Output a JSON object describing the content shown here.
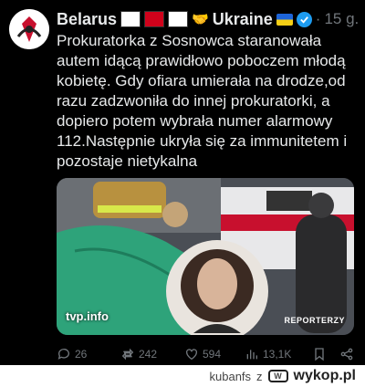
{
  "post": {
    "author_name": "Belarus",
    "author_suffix": "Ukraine",
    "separator": "·",
    "time": "15 g.",
    "text": "Prokuratorka z Sosnowca staranowała autem idącą prawidłowo poboczem młodą kobietę. Gdy ofiara umierała na drodze,od razu zadzwoniła do innej prokuratorki, a dopiero potem wybrała numer alarmowy 112.Następnie ukryła się za immunitetem i pozostaje nietykalna",
    "media_source": "tvp.info",
    "media_credit": "REPORTERZY"
  },
  "actions": {
    "replies": "26",
    "reposts": "242",
    "likes": "594",
    "views": "13,1K"
  },
  "footer": {
    "username": "kubanfs",
    "by": "z",
    "site": "wykop.pl"
  },
  "colors": {
    "accent": "#1d9bf0",
    "muted": "#71767b",
    "text": "#e7e9ea"
  }
}
